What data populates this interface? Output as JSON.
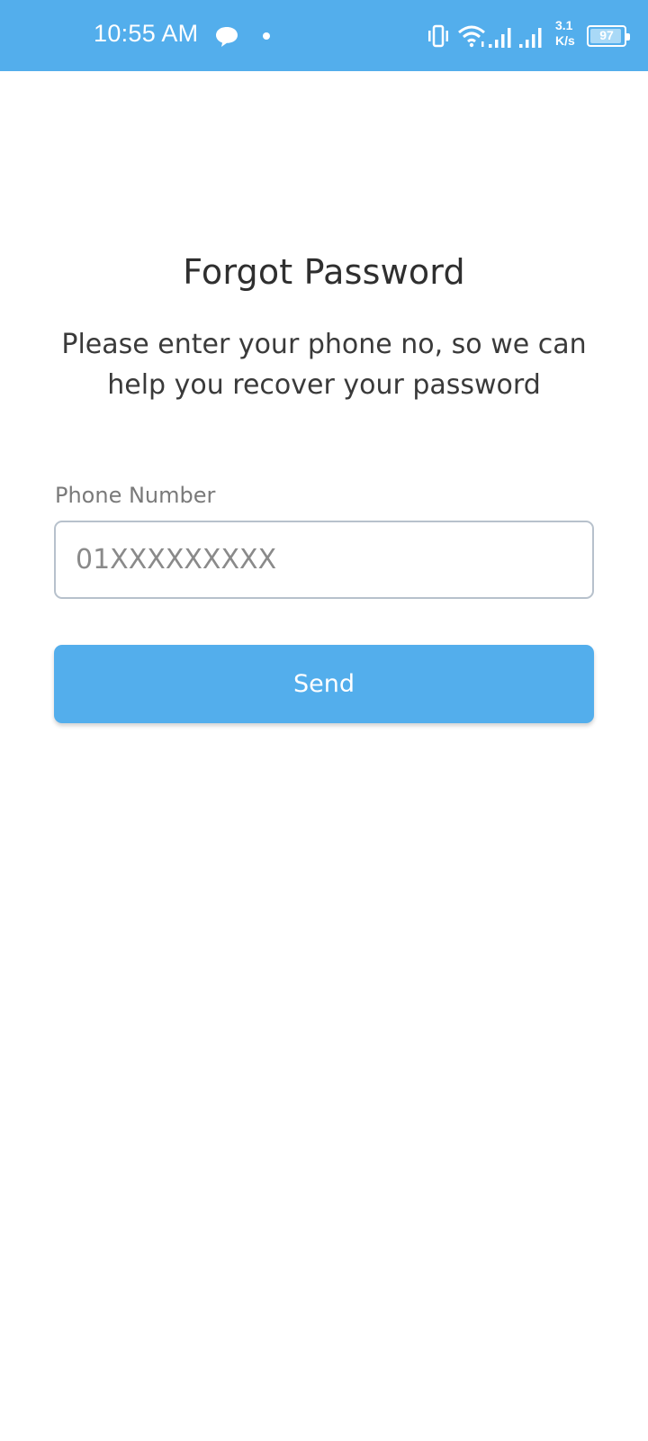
{
  "status_bar": {
    "time": "10:55 AM",
    "network_speed_value": "3.1",
    "network_speed_unit": "K/s",
    "battery_level": "97",
    "color": "#53aeec",
    "icons": [
      "chat-bubble-icon",
      "notification-dot-icon",
      "vibrate-icon",
      "wifi-icon",
      "signal-icon",
      "signal-icon",
      "battery-icon"
    ]
  },
  "screen": {
    "title": "Forgot Password",
    "subtitle": "Please enter your phone no, so we can help you recover your password",
    "phone_field": {
      "label": "Phone Number",
      "placeholder": "01XXXXXXXXX",
      "value": ""
    },
    "send_button": {
      "label": "Send",
      "color": "#53aeec"
    }
  }
}
